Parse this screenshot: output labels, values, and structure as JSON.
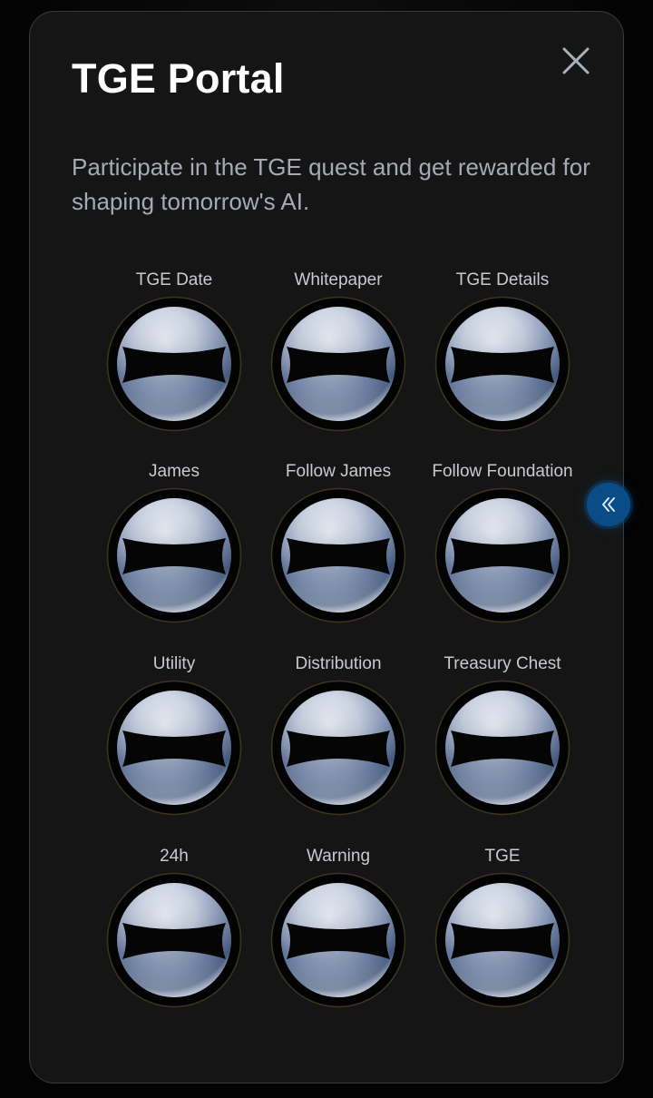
{
  "modal": {
    "title": "TGE Portal",
    "description": "Participate in the TGE quest and get rewarded for shaping tomorrow's AI.",
    "close_icon": "close-icon"
  },
  "quests": [
    {
      "label": "TGE Date",
      "icon": "quest-badge-icon"
    },
    {
      "label": "Whitepaper",
      "icon": "quest-badge-icon"
    },
    {
      "label": "TGE Details",
      "icon": "quest-badge-icon"
    },
    {
      "label": "James",
      "icon": "quest-badge-icon"
    },
    {
      "label": "Follow James",
      "icon": "quest-badge-icon"
    },
    {
      "label": "Follow Foundation",
      "icon": "quest-badge-icon"
    },
    {
      "label": "Utility",
      "icon": "quest-badge-icon"
    },
    {
      "label": "Distribution",
      "icon": "quest-badge-icon"
    },
    {
      "label": "Treasury Chest",
      "icon": "quest-badge-icon"
    },
    {
      "label": "24h",
      "icon": "quest-badge-icon"
    },
    {
      "label": "Warning",
      "icon": "quest-badge-icon"
    },
    {
      "label": "TGE",
      "icon": "quest-badge-icon"
    }
  ],
  "side_button": {
    "icon": "double-chevron-left-icon"
  },
  "colors": {
    "background": "#050505",
    "modal_background": "#151515",
    "modal_border": "#3a3a3a",
    "title": "#ffffff",
    "description": "#a6aab4",
    "label": "#c8cad0",
    "accent": "#0a4d86"
  }
}
